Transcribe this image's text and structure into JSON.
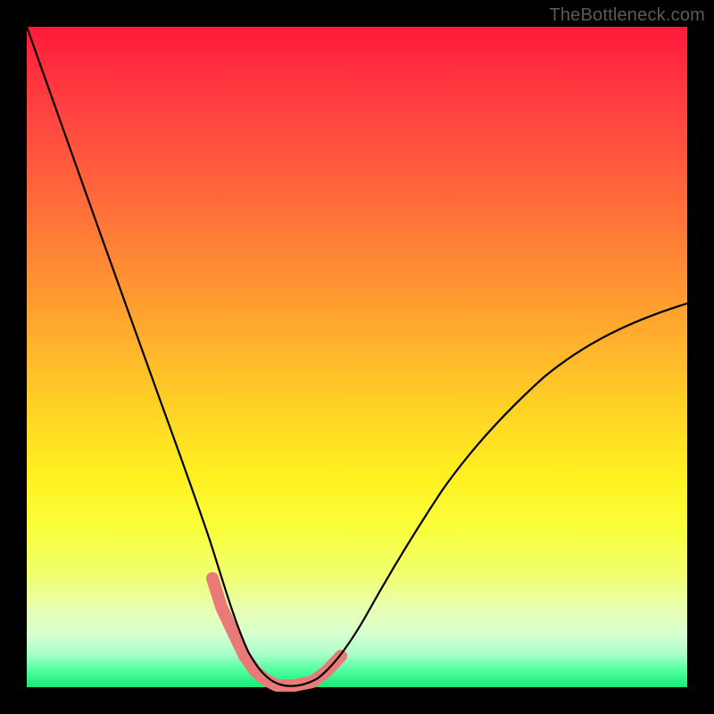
{
  "watermark": "TheBottleneck.com",
  "colors": {
    "page_bg": "#000000",
    "watermark_text": "#5a5a5a",
    "curve_stroke": "#000000",
    "data_segment_stroke": "#e97a78",
    "gradient_top": "#ff1a3a",
    "gradient_mid": "#fff020",
    "gradient_bottom": "#18e873"
  },
  "chart_data": {
    "type": "line",
    "title": "",
    "xlabel": "",
    "ylabel": "",
    "xlim": [
      0,
      100
    ],
    "ylim": [
      0,
      100
    ],
    "x": [
      0,
      3,
      6,
      9,
      12,
      15,
      18,
      21,
      24,
      26,
      28,
      30,
      31.5,
      33,
      34.5,
      36,
      38,
      40,
      43,
      46,
      50,
      55,
      60,
      66,
      73,
      80,
      88,
      95,
      100
    ],
    "y": [
      100,
      91,
      82,
      73,
      64,
      55,
      46,
      37,
      28,
      21,
      15,
      10,
      6.5,
      4,
      2,
      1,
      0.3,
      0.2,
      0.4,
      1.5,
      4,
      9,
      15,
      22,
      30,
      38,
      46,
      53,
      58
    ],
    "highlighted_points_x": [
      26,
      28,
      30,
      31.5,
      33,
      34.5,
      36,
      38,
      40,
      43,
      45,
      47
    ],
    "annotations": [],
    "legend": null,
    "grid": false
  }
}
